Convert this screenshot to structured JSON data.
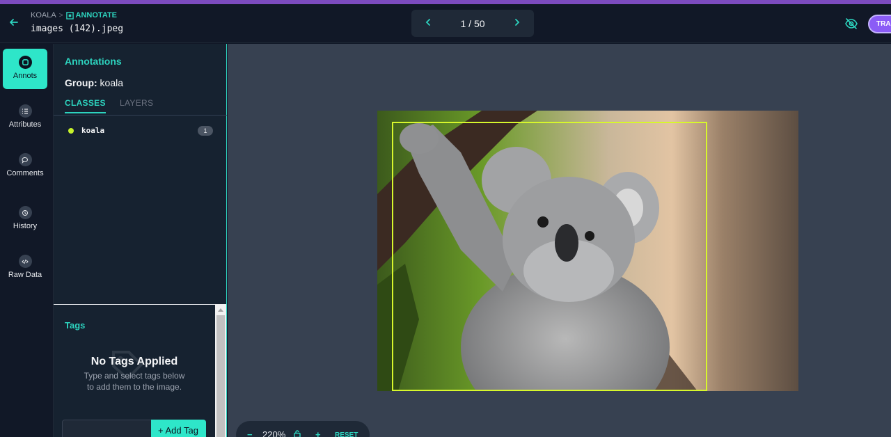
{
  "header": {
    "breadcrumb_project": "KOALA",
    "breadcrumb_section": "ANNOTATE",
    "filename": "images (142).jpeg",
    "pager": "1 / 50",
    "train_label": "TRAI"
  },
  "rail": {
    "items": [
      {
        "label": "Annots",
        "icon": "annotation-icon"
      },
      {
        "label": "Attributes",
        "icon": "list-icon"
      },
      {
        "label": "Comments",
        "icon": "comment-icon"
      },
      {
        "label": "History",
        "icon": "history-icon"
      },
      {
        "label": "Raw Data",
        "icon": "code-icon"
      }
    ]
  },
  "panel": {
    "title": "Annotations",
    "group_label": "Group:",
    "group_value": "koala",
    "tabs": [
      "CLASSES",
      "LAYERS"
    ],
    "classes": [
      {
        "name": "koala",
        "count": "1",
        "color": "#c6f22b"
      }
    ]
  },
  "tags": {
    "title": "Tags",
    "empty_title": "No Tags Applied",
    "empty_line1": "Type and select tags below",
    "empty_line2": "to add them to the image.",
    "add_button": "+ Add Tag"
  },
  "zoom": {
    "minus": "−",
    "value": "220%",
    "plus": "+",
    "reset": "RESET"
  },
  "colors": {
    "accent": "#2dd4bf",
    "bbox": "#d7f72c",
    "brand": "#8b5cf6"
  }
}
